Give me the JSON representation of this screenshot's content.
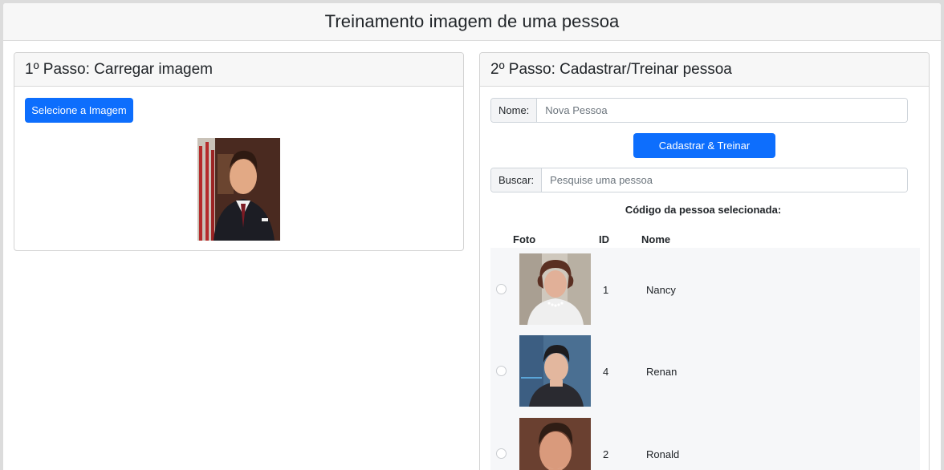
{
  "page": {
    "title": "Treinamento imagem de uma pessoa"
  },
  "step1": {
    "title": "1º Passo: Carregar imagem",
    "select_button": "Selecione a Imagem"
  },
  "step2": {
    "title": "2º Passo: Cadastrar/Treinar pessoa",
    "nome_label": "Nome:",
    "nome_placeholder": "Nova Pessoa",
    "train_button": "Cadastrar & Treinar",
    "buscar_label": "Buscar:",
    "buscar_placeholder": "Pesquise uma pessoa",
    "selected_code_label": "Código da pessoa selecionada:",
    "table": {
      "headers": [
        "Foto",
        "ID",
        "Nome"
      ],
      "rows": [
        {
          "id": "1",
          "nome": "Nancy"
        },
        {
          "id": "4",
          "nome": "Renan"
        },
        {
          "id": "2",
          "nome": "Ronald"
        }
      ]
    }
  },
  "colors": {
    "primary": "#0d6efd",
    "header_bg": "#f7f7f7",
    "table_bg": "#f6f7f9"
  }
}
